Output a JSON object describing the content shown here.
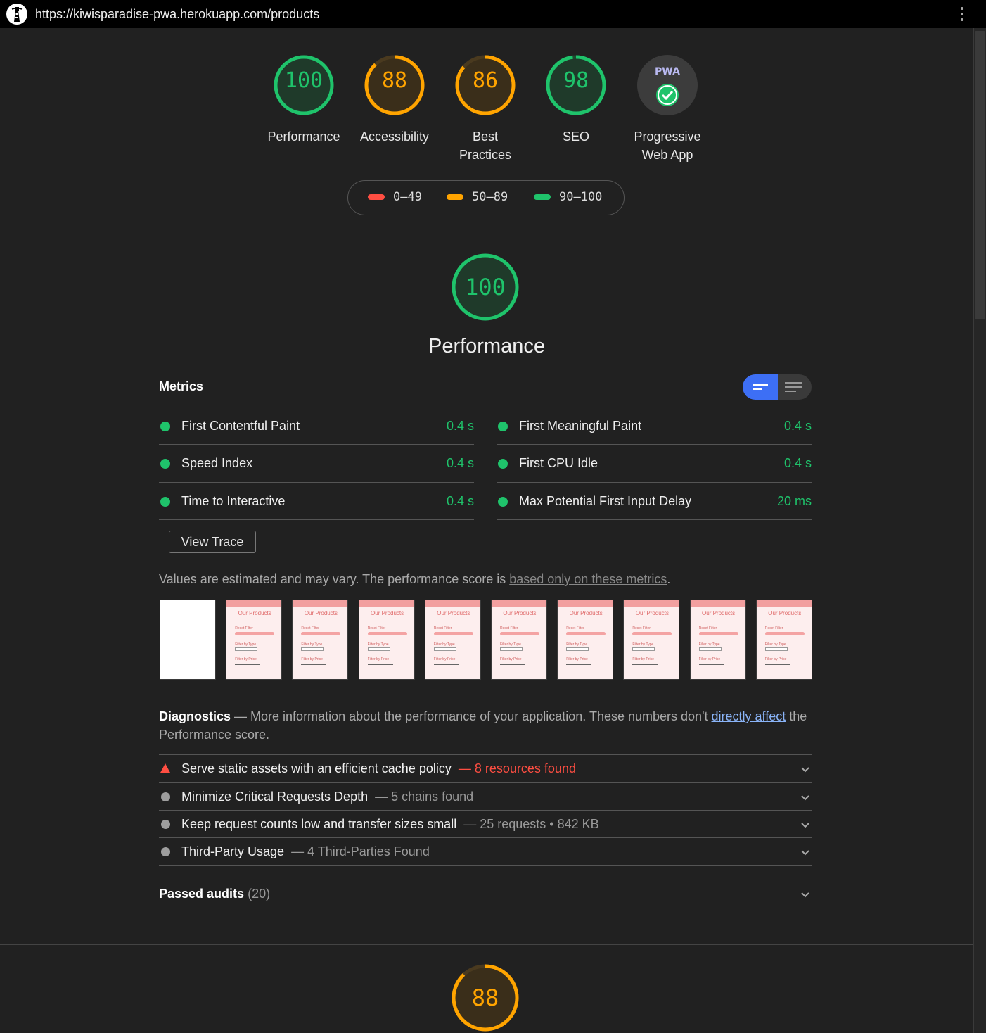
{
  "browser": {
    "url": "https://kiwisparadise-pwa.herokuapp.com/products"
  },
  "colors": {
    "pass": "#1fc36b",
    "average": "#ffa400",
    "fail": "#ff4e42",
    "toggle_active": "#3d6ff5"
  },
  "categories": [
    {
      "label": "Performance",
      "score": 100,
      "status": "pass"
    },
    {
      "label": "Accessibility",
      "score": 88,
      "status": "average"
    },
    {
      "label": "Best Practices",
      "label_line1": "Best",
      "label_line2": "Practices",
      "score": 86,
      "status": "average"
    },
    {
      "label": "SEO",
      "score": 98,
      "status": "pass"
    },
    {
      "label": "Progressive Web App",
      "label_line1": "Progressive",
      "label_line2": "Web App",
      "badge": "PWA",
      "status": "pass"
    }
  ],
  "legend": {
    "fail": "0–49",
    "average": "50–89",
    "pass": "90–100"
  },
  "performance": {
    "title": "Performance",
    "score": 100,
    "metrics_heading": "Metrics",
    "metrics_left": [
      {
        "name": "First Contentful Paint",
        "value": "0.4 s"
      },
      {
        "name": "Speed Index",
        "value": "0.4 s"
      },
      {
        "name": "Time to Interactive",
        "value": "0.4 s"
      }
    ],
    "metrics_right": [
      {
        "name": "First Meaningful Paint",
        "value": "0.4 s"
      },
      {
        "name": "First CPU Idle",
        "value": "0.4 s"
      },
      {
        "name": "Max Potential First Input Delay",
        "value": "20 ms"
      }
    ],
    "view_trace": "View Trace",
    "estimate_text": "Values are estimated and may vary. The performance score is ",
    "estimate_link": "based only on these metrics",
    "estimate_end": ".",
    "filmstrip": {
      "title": "Our Products",
      "reset": "Reset Filter",
      "filter_type": "Filter by Type",
      "filter_price": "Filter by Price"
    },
    "diagnostics": {
      "heading": "Diagnostics",
      "text_before": " — More information about the performance of your application. These numbers don't ",
      "link": "directly affect",
      "text_after": " the Performance score.",
      "items": [
        {
          "name": "Serve static assets with an efficient cache policy",
          "detail": "8 resources found",
          "severity": "fail"
        },
        {
          "name": "Minimize Critical Requests Depth",
          "detail": "5 chains found",
          "severity": "info"
        },
        {
          "name": "Keep request counts low and transfer sizes small",
          "detail": "25 requests • 842 KB",
          "severity": "info"
        },
        {
          "name": "Third-Party Usage",
          "detail": "4 Third-Parties Found",
          "severity": "info"
        }
      ]
    },
    "passed_audits": "Passed audits",
    "passed_count": "(20)"
  },
  "accessibility": {
    "score": 88
  }
}
